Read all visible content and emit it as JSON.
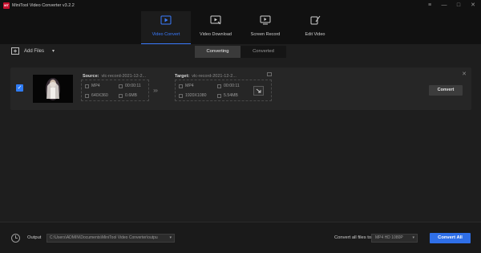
{
  "app": {
    "logo_text": "MT",
    "title": "MiniTool Video Converter v3.2.2"
  },
  "window_controls": [
    "≡",
    "—",
    "□",
    "✕"
  ],
  "nav": [
    {
      "label": "Video Convert",
      "icon": "video-convert-icon",
      "active": true
    },
    {
      "label": "Video Download",
      "icon": "video-download-icon",
      "active": false
    },
    {
      "label": "Screen Record",
      "icon": "screen-record-icon",
      "active": false
    },
    {
      "label": "Edit Video",
      "icon": "edit-video-icon",
      "active": false
    }
  ],
  "toolbar": {
    "add_files": "Add Files",
    "dropdown": "▾"
  },
  "tabs": [
    {
      "label": "Converting",
      "active": true
    },
    {
      "label": "Converted",
      "active": false
    }
  ],
  "file": {
    "checked": true,
    "source_label": "Source:",
    "source_name": "vlc-record-2021-12-2...",
    "source": {
      "format": "MP4",
      "duration": "00:00:11",
      "resolution": "640X360",
      "size": "0.6MB"
    },
    "target_label": "Target:",
    "target_name": "vlc-record-2021-12-2...",
    "target": {
      "format": "MP4",
      "duration": "00:00:11",
      "resolution": "1920X1080",
      "size": "5.54MB"
    },
    "arrows": "›››",
    "convert_label": "Convert",
    "close": "✕"
  },
  "bottom": {
    "output_label": "Output",
    "output_path": "C:\\Users\\ADMIN\\Documents\\MiniTool Video Converter\\outpu",
    "convert_all_files_to": "Convert all files to",
    "format_value": "MP4 HD 1080P",
    "convert_all_label": "Convert All"
  },
  "colors": {
    "accent": "#3a7bff",
    "brand": "#c8102e",
    "button_primary": "#2f6fe8"
  }
}
